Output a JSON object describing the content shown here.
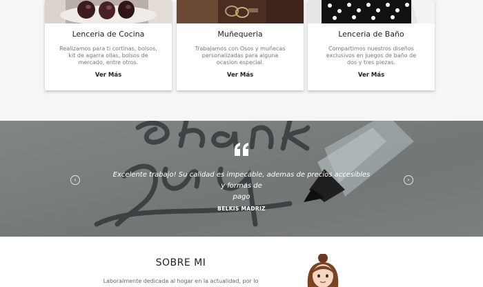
{
  "services": [
    {
      "title": "Lenceria de Cocina",
      "lines": [
        "Realizamos para ti cortinas, bolsos,",
        "kit de agarra ollas, bolsos de",
        "mercado, entre otros."
      ],
      "more": "Ver Más"
    },
    {
      "title": "Muñequeria",
      "lines": [
        "Trabajamos con Osos y muñecas",
        "personalizadas para alguna",
        "ocasion especial."
      ],
      "more": "Ver Más"
    },
    {
      "title": "Lenceria de Baño",
      "lines": [
        "Compartimos nuestros diseños",
        "exclusivos en juegos de baño de",
        "dos y tres piezas."
      ],
      "more": "Ver Más"
    }
  ],
  "testimonial": {
    "quote_lines": [
      "Excelente trabajo! Su calidad es impecable, ademas de precios accesibles y formas de",
      "pago"
    ],
    "author": "BELKIS MADRIZ",
    "prev_arrow": "‹",
    "next_arrow": "›"
  },
  "about": {
    "title": "SOBRE MI",
    "text": "Laboralmente dedicada al hogar en la actualidad, por lo"
  }
}
